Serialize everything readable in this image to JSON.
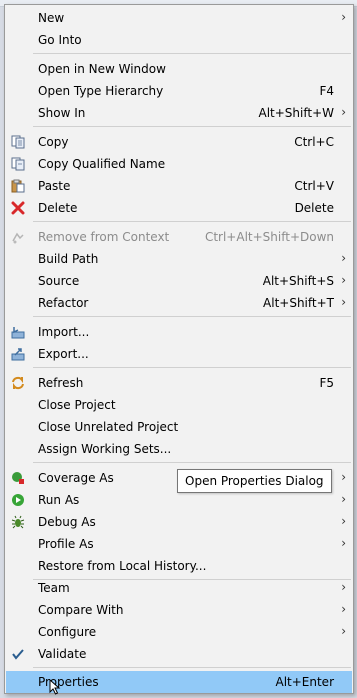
{
  "menu": {
    "new": {
      "label": "New",
      "submenu": true
    },
    "go_into": {
      "label": "Go Into"
    },
    "open_new_window": {
      "label": "Open in New Window"
    },
    "open_type_hierarchy": {
      "label": "Open Type Hierarchy",
      "shortcut": "F4"
    },
    "show_in": {
      "label": "Show In",
      "shortcut": "Alt+Shift+W",
      "submenu": true
    },
    "copy": {
      "label": "Copy",
      "shortcut": "Ctrl+C",
      "icon": "copy-icon"
    },
    "copy_qualified_name": {
      "label": "Copy Qualified Name",
      "icon": "copy-qualified-name-icon"
    },
    "paste": {
      "label": "Paste",
      "shortcut": "Ctrl+V",
      "icon": "paste-icon"
    },
    "delete": {
      "label": "Delete",
      "shortcut": "Delete",
      "icon": "delete-icon"
    },
    "remove_from_context": {
      "label": "Remove from Context",
      "shortcut": "Ctrl+Alt+Shift+Down",
      "disabled": true,
      "icon": "remove-context-icon"
    },
    "build_path": {
      "label": "Build Path",
      "submenu": true
    },
    "source": {
      "label": "Source",
      "shortcut": "Alt+Shift+S",
      "submenu": true
    },
    "refactor": {
      "label": "Refactor",
      "shortcut": "Alt+Shift+T",
      "submenu": true
    },
    "import": {
      "label": "Import...",
      "icon": "import-icon"
    },
    "export": {
      "label": "Export...",
      "icon": "export-icon"
    },
    "refresh": {
      "label": "Refresh",
      "shortcut": "F5",
      "icon": "refresh-icon"
    },
    "close_project": {
      "label": "Close Project"
    },
    "close_unrelated_project": {
      "label": "Close Unrelated Project"
    },
    "assign_working_sets": {
      "label": "Assign Working Sets..."
    },
    "coverage_as": {
      "label": "Coverage As",
      "submenu": true,
      "icon": "coverage-icon"
    },
    "run_as": {
      "label": "Run As",
      "submenu": true,
      "icon": "run-icon"
    },
    "debug_as": {
      "label": "Debug As",
      "submenu": true,
      "icon": "debug-icon"
    },
    "profile_as": {
      "label": "Profile As",
      "submenu": true
    },
    "restore_local_history": {
      "label": "Restore from Local History..."
    },
    "team": {
      "label": "Team",
      "submenu": true
    },
    "compare_with": {
      "label": "Compare With",
      "submenu": true
    },
    "configure": {
      "label": "Configure",
      "submenu": true
    },
    "validate": {
      "label": "Validate",
      "icon": "checkmark-icon"
    },
    "properties": {
      "label": "Properties",
      "shortcut": "Alt+Enter",
      "highlighted": true
    }
  },
  "tooltip": {
    "text": "Open Properties Dialog"
  },
  "colors": {
    "highlight": "#91c9f7",
    "menu_background": "#f2f2f2",
    "disabled_text": "#8c8c8c"
  }
}
